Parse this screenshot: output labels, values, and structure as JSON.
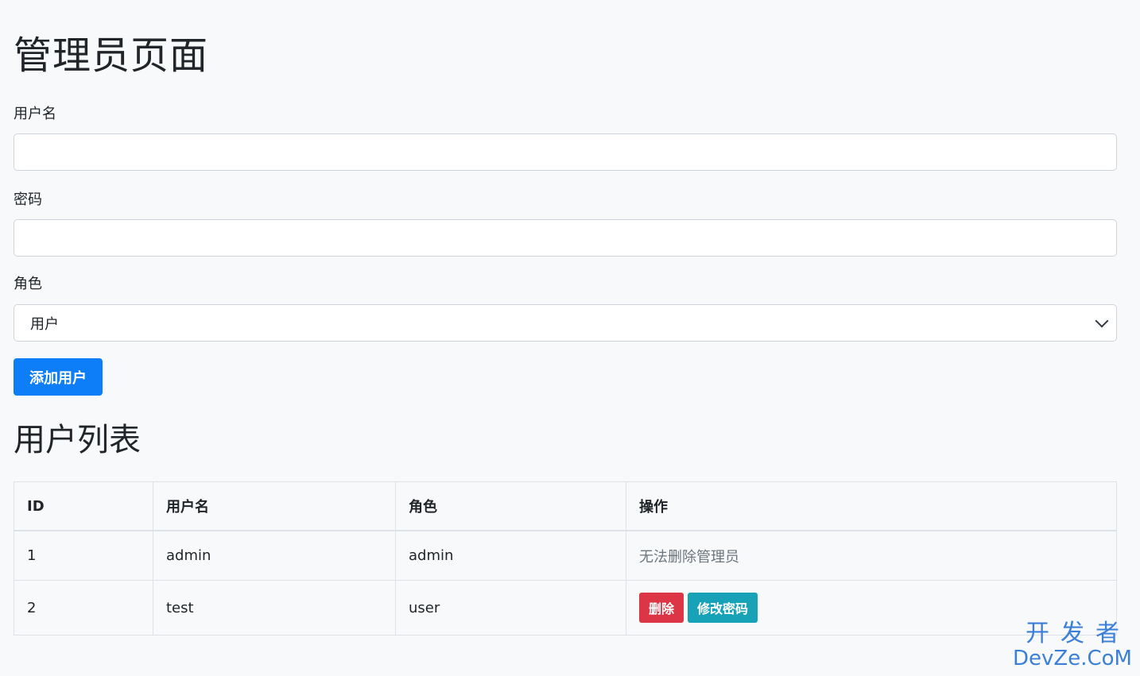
{
  "page": {
    "title": "管理员页面"
  },
  "form": {
    "username_label": "用户名",
    "username_value": "",
    "password_label": "密码",
    "password_value": "",
    "role_label": "角色",
    "role_selected": "用户",
    "submit_label": "添加用户"
  },
  "list": {
    "title": "用户列表",
    "columns": [
      "ID",
      "用户名",
      "角色",
      "操作"
    ],
    "rows": [
      {
        "id": "1",
        "username": "admin",
        "role": "admin",
        "action_text": "无法删除管理员"
      },
      {
        "id": "2",
        "username": "test",
        "role": "user",
        "delete_label": "删除",
        "change_password_label": "修改密码"
      }
    ]
  },
  "watermark": {
    "line1": "开发者",
    "line2": "DevZe.CoM"
  },
  "colors": {
    "primary": "#0d7ef7",
    "danger": "#dc3545",
    "info": "#17a2b8",
    "background": "#f8f9fa"
  }
}
